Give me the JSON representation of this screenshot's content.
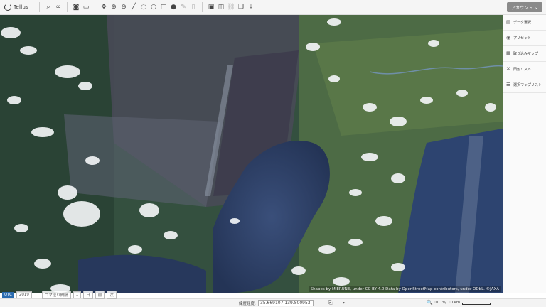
{
  "app": {
    "name": "Tellus"
  },
  "toolbar": {
    "groups": [
      [
        {
          "icon": "search-icon",
          "glyph": "⌕"
        },
        {
          "icon": "link-icon",
          "glyph": "∞"
        }
      ],
      [
        {
          "icon": "camera-icon",
          "glyph": "◙"
        },
        {
          "icon": "image-icon",
          "glyph": "▭"
        }
      ],
      [
        {
          "icon": "move-icon",
          "glyph": "✥"
        },
        {
          "icon": "zoom-in-icon",
          "glyph": "⊕"
        },
        {
          "icon": "zoom-out-icon",
          "glyph": "⊖"
        },
        {
          "icon": "line-icon",
          "glyph": "╱"
        },
        {
          "icon": "lasso-icon",
          "glyph": "◌"
        },
        {
          "icon": "circle-icon",
          "glyph": "○"
        },
        {
          "icon": "rectangle-icon",
          "glyph": "□"
        },
        {
          "icon": "pin-icon",
          "glyph": "●"
        },
        {
          "icon": "edit-icon",
          "glyph": "✎",
          "dim": true
        },
        {
          "icon": "trash-icon",
          "glyph": "▯",
          "dim": true
        }
      ],
      [
        {
          "icon": "window-icon",
          "glyph": "▣"
        },
        {
          "icon": "split-view-icon",
          "glyph": "◫"
        },
        {
          "icon": "chain-icon",
          "glyph": "⛓",
          "dim": true
        },
        {
          "icon": "layers-icon",
          "glyph": "❐"
        },
        {
          "icon": "download-icon",
          "glyph": "⤓"
        }
      ]
    ],
    "account_label": "アカウント",
    "account_caret": "⌄"
  },
  "sidebar": {
    "items": [
      {
        "icon": "database-icon",
        "glyph": "▤",
        "label": "データ選択"
      },
      {
        "icon": "preset-icon",
        "glyph": "◉",
        "label": "プリセット"
      },
      {
        "icon": "stack-icon",
        "glyph": "▦",
        "label": "取り込みマップ"
      },
      {
        "icon": "tools-icon",
        "glyph": "✕",
        "label": "図形リスト"
      },
      {
        "icon": "list-icon",
        "glyph": "☰",
        "label": "選択マップリスト"
      }
    ]
  },
  "map": {
    "attribution": "Shapes by MIERUNE, under CC BY 4.0 Data by OpenStreetMap contributors, under ODbL. ©JAXA"
  },
  "timebar": {
    "timezone": "UTC",
    "year": "2019",
    "prev": "‹",
    "next": "›",
    "mode_label": "コマ送り間隔",
    "step": "1",
    "unit": "日",
    "extra1": "前",
    "extra2": "次"
  },
  "status": {
    "coord_label": "緯度経度:",
    "coord_value": "35.669107,139.800953",
    "copy_glyph": "⎘",
    "play_glyph": "▸",
    "zoom_glyph": "🔍",
    "zoom_level": "10",
    "pencil_glyph": "✎",
    "scale_label": "10 km"
  }
}
